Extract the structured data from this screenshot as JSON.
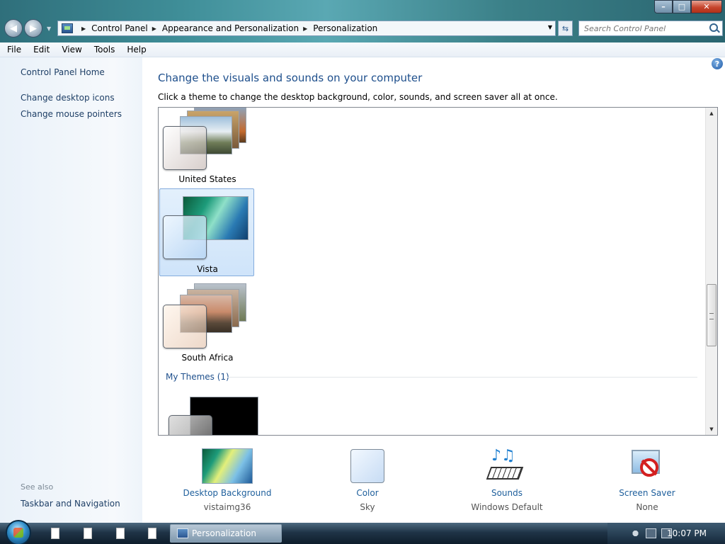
{
  "address": {
    "crumbs": [
      "Control Panel",
      "Appearance and Personalization",
      "Personalization"
    ]
  },
  "search": {
    "placeholder": "Search Control Panel"
  },
  "menu": [
    "File",
    "Edit",
    "View",
    "Tools",
    "Help"
  ],
  "sidebar": {
    "home": "Control Panel Home",
    "links": [
      "Change desktop icons",
      "Change mouse pointers"
    ],
    "see_also": "See also",
    "see_also_links": [
      "Taskbar and Navigation"
    ]
  },
  "main": {
    "heading": "Change the visuals and sounds on your computer",
    "subheading": "Click a theme to change the desktop background, color, sounds, and screen saver all at once.",
    "themes": [
      {
        "name": "United States",
        "selected": false
      },
      {
        "name": "Vista",
        "selected": true
      },
      {
        "name": "South Africa",
        "selected": false
      }
    ],
    "my_themes_label": "My Themes (1)"
  },
  "settings": [
    {
      "name": "Desktop Background",
      "value": "vistaimg36",
      "icon": "wallpaper-icon"
    },
    {
      "name": "Color",
      "value": "Sky",
      "icon": "color-swatch-icon"
    },
    {
      "name": "Sounds",
      "value": "Windows Default",
      "icon": "sounds-icon"
    },
    {
      "name": "Screen Saver",
      "value": "None",
      "icon": "screen-saver-icon"
    }
  ],
  "taskbar": {
    "active_task": "Personalization",
    "clock": "10:07 PM"
  }
}
